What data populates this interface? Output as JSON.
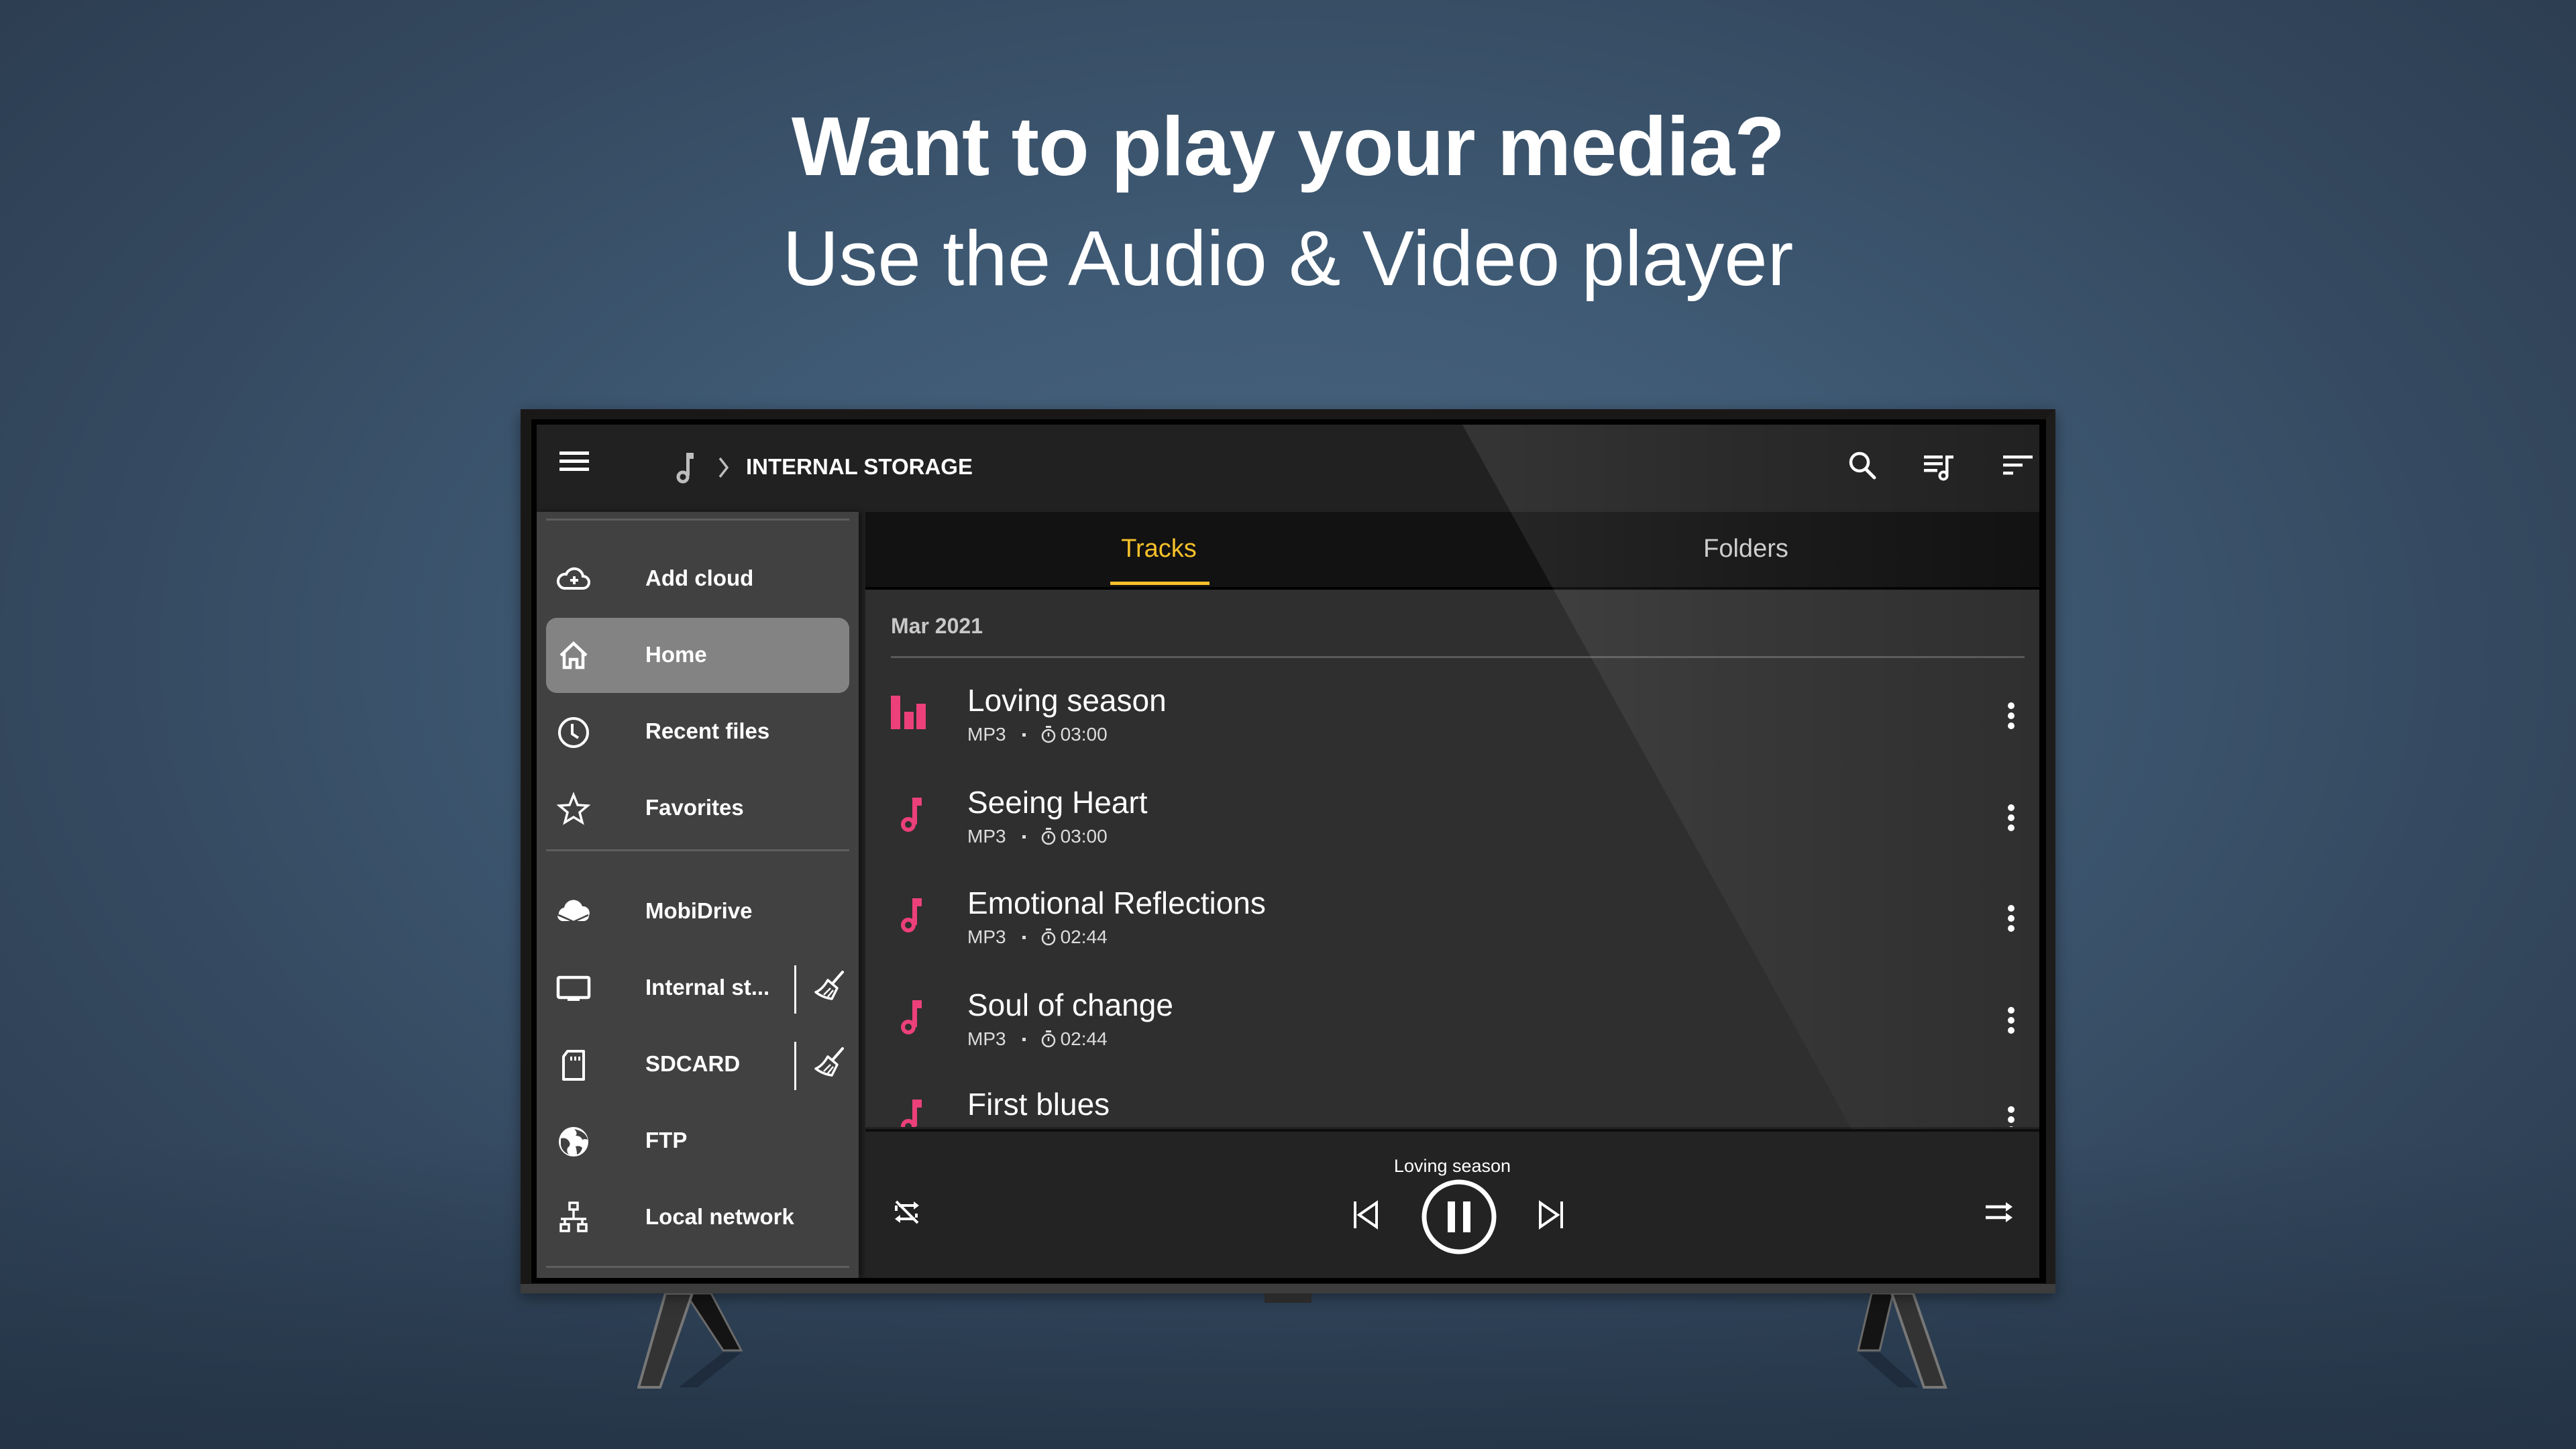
{
  "promo": {
    "headline": "Want to play your media?",
    "subline": "Use the Audio & Video player"
  },
  "header": {
    "menu_icon": "hamburger-menu-icon",
    "breadcrumb_icon": "music-note-icon",
    "breadcrumb_separator": "chevron-right-icon",
    "breadcrumb_location": "INTERNAL STORAGE",
    "actions": [
      {
        "name": "search",
        "icon": "search-icon"
      },
      {
        "name": "playlist",
        "icon": "playlist-music-icon"
      },
      {
        "name": "sort",
        "icon": "sort-icon"
      }
    ]
  },
  "sidebar": {
    "items": [
      {
        "label": "Add cloud",
        "icon": "cloud-add-icon",
        "active": false
      },
      {
        "label": "Home",
        "icon": "home-icon",
        "active": true
      },
      {
        "label": "Recent files",
        "icon": "clock-icon",
        "active": false
      },
      {
        "label": "Favorites",
        "icon": "star-icon",
        "active": false
      },
      {
        "label": "MobiDrive",
        "icon": "mobidrive-cloud-icon",
        "active": false
      },
      {
        "label": "Internal st...",
        "icon": "tv-monitor-icon",
        "active": false,
        "action_icon": "broom-clean-icon"
      },
      {
        "label": "SDCARD",
        "icon": "sd-card-icon",
        "active": false,
        "action_icon": "broom-clean-icon"
      },
      {
        "label": "FTP",
        "icon": "globe-icon",
        "active": false
      },
      {
        "label": "Local network",
        "icon": "network-icon",
        "active": false
      }
    ]
  },
  "tabs": [
    {
      "label": "Tracks",
      "active": true
    },
    {
      "label": "Folders",
      "active": false
    }
  ],
  "list": {
    "section": "Mar 2021",
    "tracks": [
      {
        "title": "Loving season",
        "format": "MP3",
        "duration": "03:00",
        "playing": true
      },
      {
        "title": "Seeing Heart",
        "format": "MP3",
        "duration": "03:00",
        "playing": false
      },
      {
        "title": "Emotional Reflections",
        "format": "MP3",
        "duration": "02:44",
        "playing": false
      },
      {
        "title": "Soul of change",
        "format": "MP3",
        "duration": "02:44",
        "playing": false
      },
      {
        "title": "First blues",
        "format": "",
        "duration": "",
        "playing": false
      }
    ]
  },
  "player": {
    "now_playing": "Loving season",
    "state": "playing",
    "controls": [
      "repeat-off-icon",
      "skip-previous-icon",
      "pause-icon",
      "skip-next-icon",
      "shuffle-off-icon"
    ]
  },
  "colors": {
    "accent": "#f7c12a",
    "track_icon": "#ec407a",
    "background": "#3f5a74"
  }
}
